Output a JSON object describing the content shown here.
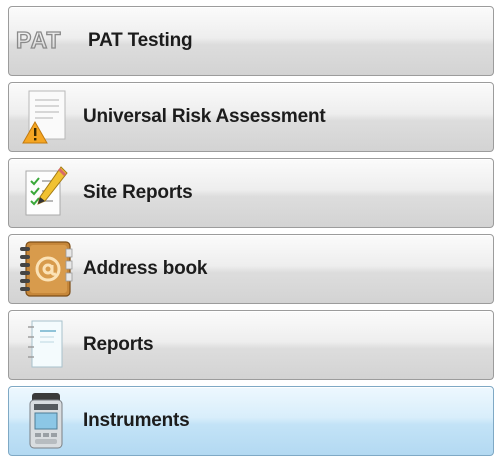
{
  "menu": {
    "items": [
      {
        "label": "PAT Testing",
        "icon": "pat-logo-icon",
        "logo_text": "PAT",
        "active": false
      },
      {
        "label": "Universal Risk Assessment",
        "icon": "warning-document-icon",
        "active": false
      },
      {
        "label": "Site Reports",
        "icon": "checklist-pencil-icon",
        "active": false
      },
      {
        "label": "Address book",
        "icon": "address-book-icon",
        "active": false
      },
      {
        "label": "Reports",
        "icon": "report-document-icon",
        "active": false
      },
      {
        "label": "Instruments",
        "icon": "instrument-device-icon",
        "active": true
      }
    ]
  },
  "colors": {
    "active_background": "#c3e3f7",
    "warning": "#f5a623",
    "address_book": "#c6873a",
    "check": "#3aa83a"
  }
}
